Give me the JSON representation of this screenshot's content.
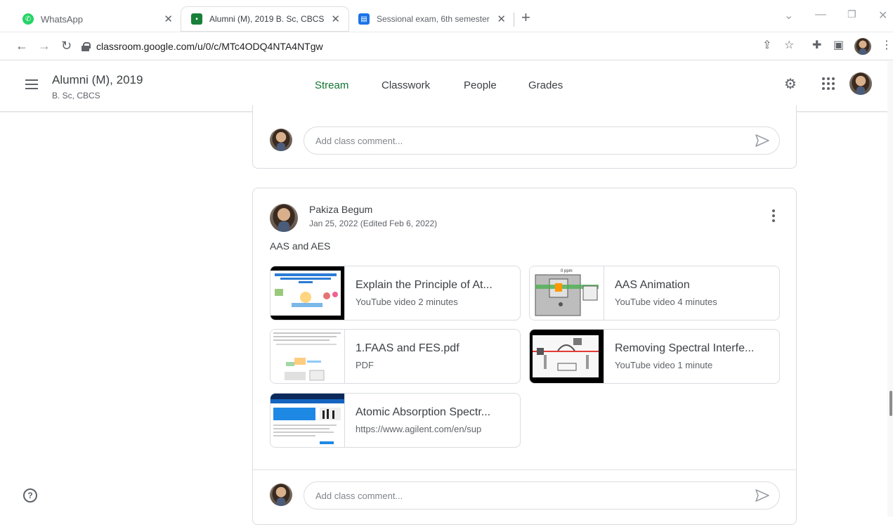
{
  "browser": {
    "tabs": [
      {
        "title": "WhatsApp",
        "icon": "whatsapp-icon",
        "color": "#25d366"
      },
      {
        "title": "Alumni (M), 2019 B. Sc, CBCS",
        "icon": "classroom-icon",
        "color": "#188038"
      },
      {
        "title": "Sessional exam, 6th semester",
        "icon": "forms-icon",
        "color": "#1a73e8"
      }
    ],
    "url": "classroom.google.com/u/0/c/MTc4ODQ4NTA4NTgw"
  },
  "header": {
    "class_name": "Alumni (M), 2019",
    "section": "B. Sc, CBCS",
    "tabs": [
      "Stream",
      "Classwork",
      "People",
      "Grades"
    ],
    "active_tab": "Stream",
    "accent": "#137333"
  },
  "top_comment": {
    "placeholder": "Add class comment..."
  },
  "post": {
    "author": "Pakiza Begum",
    "date": "Jan 25, 2022 (Edited Feb 6, 2022)",
    "text": "AAS and AES",
    "attachments": [
      {
        "title": "Explain the Principle of At...",
        "subtitle": "YouTube video   2 minutes",
        "kind": "video"
      },
      {
        "title": "AAS Animation",
        "subtitle": "YouTube video   4 minutes",
        "kind": "video",
        "thumb_label": "0 ppm"
      },
      {
        "title": "1.FAAS and FES.pdf",
        "subtitle": "PDF",
        "kind": "pdf"
      },
      {
        "title": "Removing Spectral Interfe...",
        "subtitle": "YouTube video   1 minute",
        "kind": "video"
      },
      {
        "title": "Atomic Absorption Spectr...",
        "subtitle": "https://www.agilent.com/en/sup",
        "kind": "link"
      }
    ],
    "comment_placeholder": "Add class comment..."
  }
}
